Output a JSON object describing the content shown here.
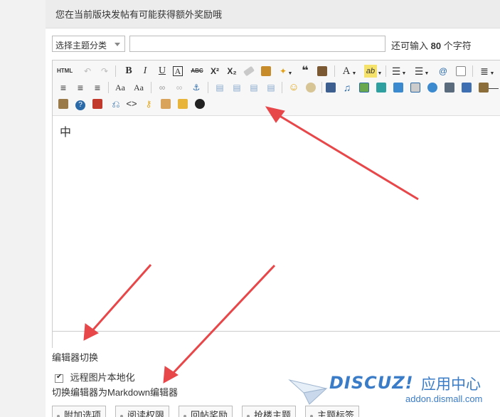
{
  "notice": {
    "text": "您在当前版块发帖有可能获得额外奖励哦"
  },
  "form": {
    "category_select": "选择主题分类",
    "remain_prefix": "还可输入",
    "remain_count": "80",
    "remain_suffix": "个字符"
  },
  "editor": {
    "html_label": "HTML",
    "content_text": "中"
  },
  "bottom": {
    "switch_label": "编辑器切换",
    "checkbox_label": "远程图片本地化",
    "md_switch": "切换编辑器为Markdown编辑器"
  },
  "tabs": [
    "附加选项",
    "阅读权限",
    "回帖奖励",
    "抢楼主题",
    "主题标签"
  ],
  "logo": {
    "brand": "DISCUZ!",
    "cn": "应用中心",
    "url": "addon.dismall.com"
  },
  "colors": {
    "arrow": "#e8474a",
    "brand": "#3a7cc7"
  }
}
